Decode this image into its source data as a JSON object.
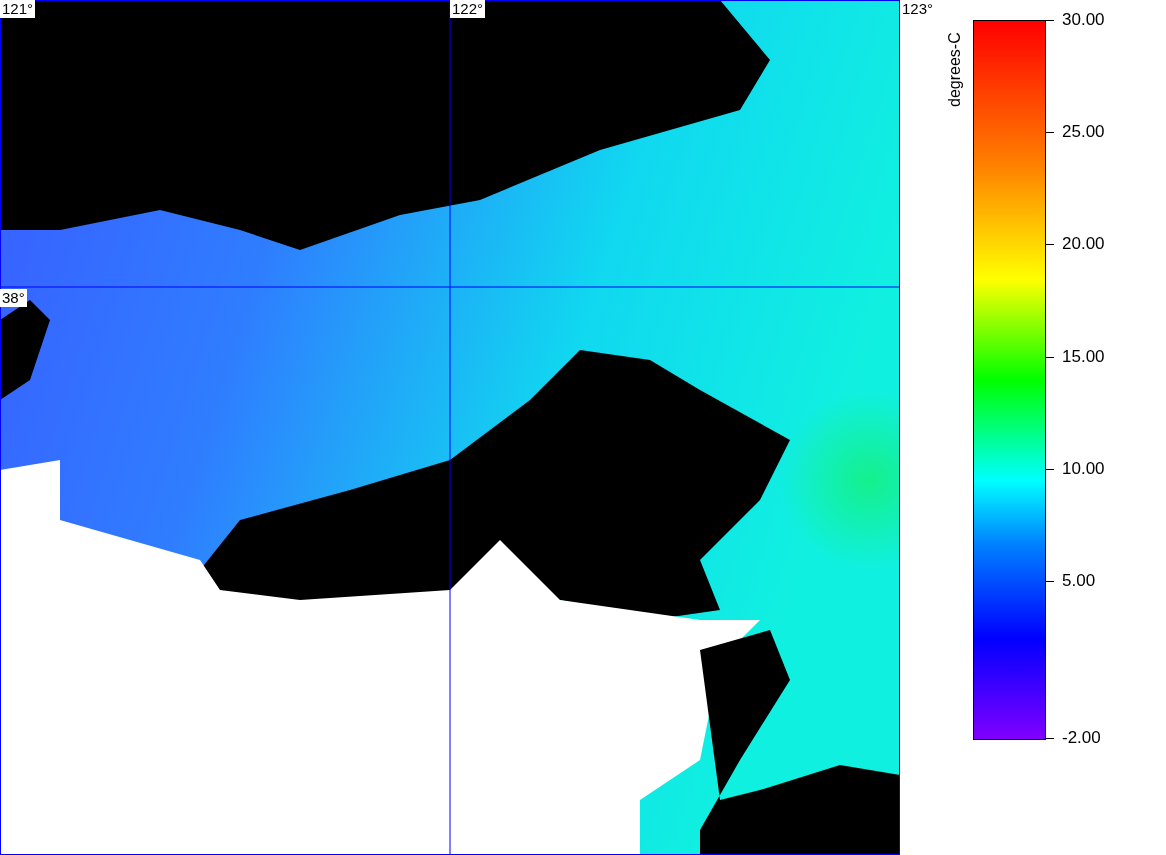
{
  "map": {
    "lon_labels": [
      "121°",
      "122°",
      "123°"
    ],
    "lat_labels": [
      "38°"
    ]
  },
  "colorbar": {
    "title": "degrees-C",
    "ticks": [
      "30.00",
      "25.00",
      "20.00",
      "15.00",
      "10.00",
      "5.00",
      "-2.00"
    ]
  }
}
